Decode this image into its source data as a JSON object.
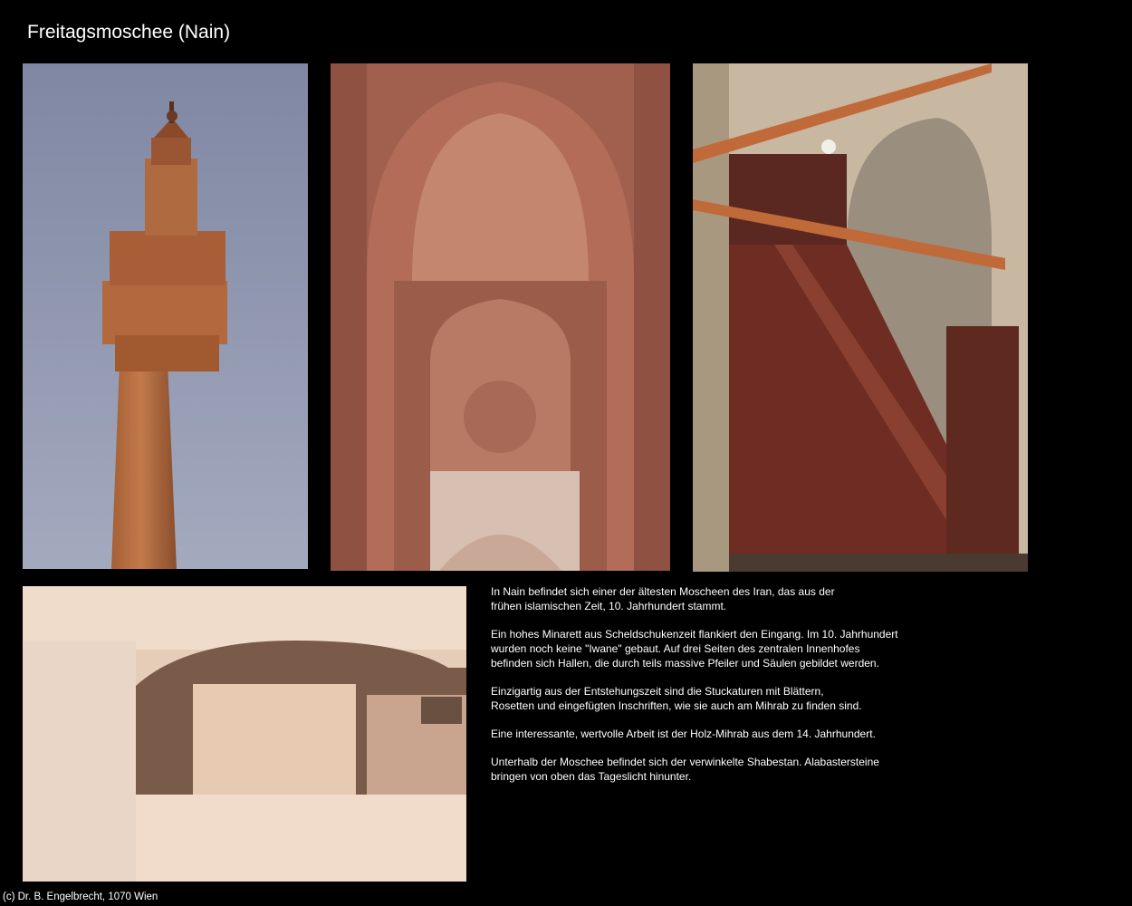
{
  "page": {
    "title": "Freitagsmoschee (Nain)",
    "copyright": "(c) Dr. B. Engelbrecht, 1070 Wien"
  },
  "description": [
    "In Nain befindet sich einer der ältesten Moscheen des Iran, das aus der\nfrühen islamischen Zeit, 10. Jahrhundert stammt.",
    "Ein hohes Minarett aus Scheldschukenzeit flankiert den Eingang. Im 10. Jahrhundert\nwurden noch keine \"Iwane\" gebaut. Auf drei Seiten des zentralen Innenhofes\nbefinden sich Hallen, die durch teils massive Pfeiler und Säulen gebildet werden.",
    "Einzigartig aus der Entstehungszeit sind die Stuckaturen mit Blättern,\nRosetten und eingefügten Inschriften, wie sie auch am Mihrab zu finden sind.",
    "Eine interessante, wertvolle Arbeit ist der Holz-Mihrab aus dem 14. Jahrhundert.",
    "Unterhalb der Moschee befindet sich der verwinkelte Shabestan. Alabastersteine\nbringen von oben das Tageslicht hinunter."
  ],
  "colors": {
    "background": "#000000",
    "text": "#ffffff",
    "sky": "#8c95ad",
    "brick": "#b46a3e",
    "stucco": "#a86450",
    "wood": "#6a2a22",
    "cave": "#d8b49a"
  }
}
